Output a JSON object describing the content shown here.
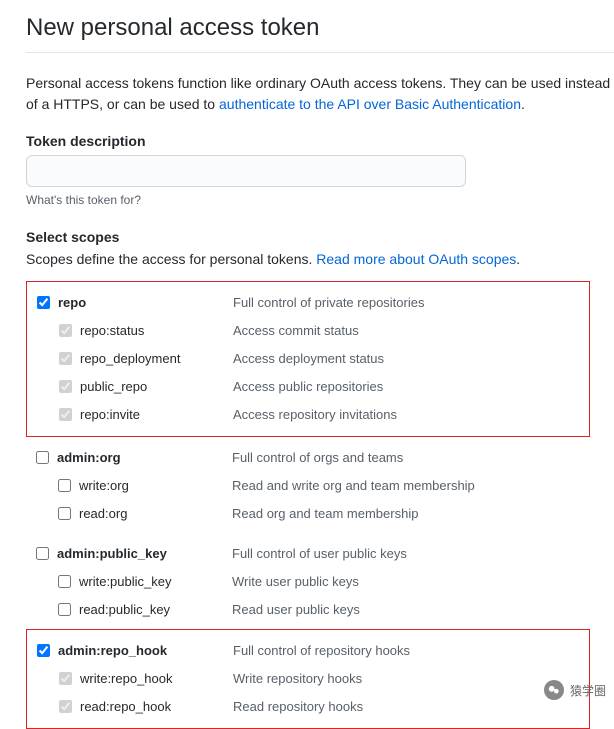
{
  "title": "New personal access token",
  "intro_text_1": "Personal access tokens function like ordinary OAuth access tokens. They can be used instead of a HTTPS, or can be used to ",
  "intro_link": "authenticate to the API over Basic Authentication",
  "intro_text_2": ".",
  "token_label": "Token description",
  "token_value": "",
  "token_hint": "What's this token for?",
  "scopes_label": "Select scopes",
  "scopes_desc": "Scopes define the access for personal tokens. ",
  "scopes_desc_link": "Read more about OAuth scopes",
  "scope_groups": [
    {
      "boxed": true,
      "parent": {
        "name": "repo",
        "desc": "Full control of private repositories",
        "checked": true
      },
      "children": [
        {
          "name": "repo:status",
          "desc": "Access commit status",
          "checked": true
        },
        {
          "name": "repo_deployment",
          "desc": "Access deployment status",
          "checked": true
        },
        {
          "name": "public_repo",
          "desc": "Access public repositories",
          "checked": true
        },
        {
          "name": "repo:invite",
          "desc": "Access repository invitations",
          "checked": true
        }
      ]
    },
    {
      "boxed": false,
      "parent": {
        "name": "admin:org",
        "desc": "Full control of orgs and teams",
        "checked": false
      },
      "children": [
        {
          "name": "write:org",
          "desc": "Read and write org and team membership",
          "checked": false
        },
        {
          "name": "read:org",
          "desc": "Read org and team membership",
          "checked": false
        }
      ]
    },
    {
      "boxed": false,
      "parent": {
        "name": "admin:public_key",
        "desc": "Full control of user public keys",
        "checked": false
      },
      "children": [
        {
          "name": "write:public_key",
          "desc": "Write user public keys",
          "checked": false
        },
        {
          "name": "read:public_key",
          "desc": "Read user public keys",
          "checked": false
        }
      ]
    },
    {
      "boxed": true,
      "parent": {
        "name": "admin:repo_hook",
        "desc": "Full control of repository hooks",
        "checked": true
      },
      "children": [
        {
          "name": "write:repo_hook",
          "desc": "Write repository hooks",
          "checked": true
        },
        {
          "name": "read:repo_hook",
          "desc": "Read repository hooks",
          "checked": true
        }
      ]
    }
  ],
  "footer_text": "猿学圈"
}
